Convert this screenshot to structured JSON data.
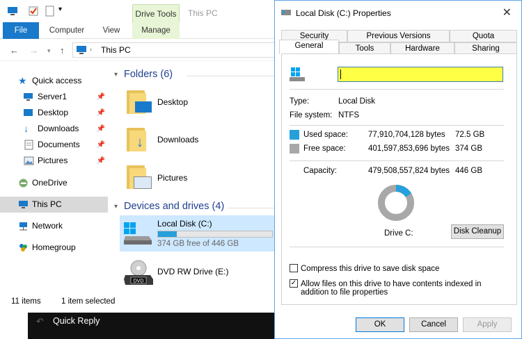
{
  "explorer": {
    "context_tab": "Drive Tools",
    "title": "This PC",
    "ribbon_tabs": [
      "File",
      "Computer",
      "View",
      "Manage"
    ],
    "address": "This PC",
    "nav": [
      {
        "label": "Quick access",
        "icon": "star-icon"
      },
      {
        "label": "Server1",
        "icon": "monitor-icon",
        "pinned": true
      },
      {
        "label": "Desktop",
        "icon": "desktop-icon",
        "pinned": true
      },
      {
        "label": "Downloads",
        "icon": "download-icon",
        "pinned": true
      },
      {
        "label": "Documents",
        "icon": "document-icon",
        "pinned": true
      },
      {
        "label": "Pictures",
        "icon": "picture-icon",
        "pinned": true
      },
      {
        "label": "OneDrive",
        "icon": "cloud-icon"
      },
      {
        "label": "This PC",
        "icon": "computer-icon",
        "selected": true
      },
      {
        "label": "Network",
        "icon": "network-icon"
      },
      {
        "label": "Homegroup",
        "icon": "homegroup-icon"
      }
    ],
    "folders_heading": "Folders (6)",
    "folders": [
      "Desktop",
      "Downloads",
      "Pictures"
    ],
    "devices_heading": "Devices and drives (4)",
    "drives": [
      {
        "name": "Local Disk (C:)",
        "free_text": "374 GB free of 446 GB",
        "used_fraction": 0.162
      },
      {
        "name": "DVD RW Drive (E:)"
      }
    ],
    "status_items": "11 items",
    "status_selected": "1 item selected",
    "quick_reply": "Quick Reply"
  },
  "dialog": {
    "title": "Local Disk (C:) Properties",
    "tabs_top": [
      "Security",
      "Previous Versions",
      "Quota"
    ],
    "tabs_bottom": [
      "General",
      "Tools",
      "Hardware",
      "Sharing"
    ],
    "name_value": "",
    "type_label": "Type:",
    "type_value": "Local Disk",
    "fs_label": "File system:",
    "fs_value": "NTFS",
    "used_label": "Used space:",
    "used_bytes": "77,910,704,128 bytes",
    "used_gb": "72.5 GB",
    "free_label": "Free space:",
    "free_bytes": "401,597,853,696 bytes",
    "free_gb": "374 GB",
    "capacity_label": "Capacity:",
    "capacity_bytes": "479,508,557,824 bytes",
    "capacity_gb": "446 GB",
    "drive_label": "Drive C:",
    "used_fraction": 0.162,
    "disk_cleanup": "Disk Cleanup",
    "compress_label": "Compress this drive to save disk space",
    "compress_checked": false,
    "index_label": "Allow files on this drive to have contents indexed in addition to file properties",
    "index_checked": true,
    "ok": "OK",
    "cancel": "Cancel",
    "apply": "Apply",
    "colors": {
      "used": "#26a0da",
      "free": "#a8a8a8",
      "accent": "#1979ca",
      "highlight": "#ffff46"
    }
  }
}
